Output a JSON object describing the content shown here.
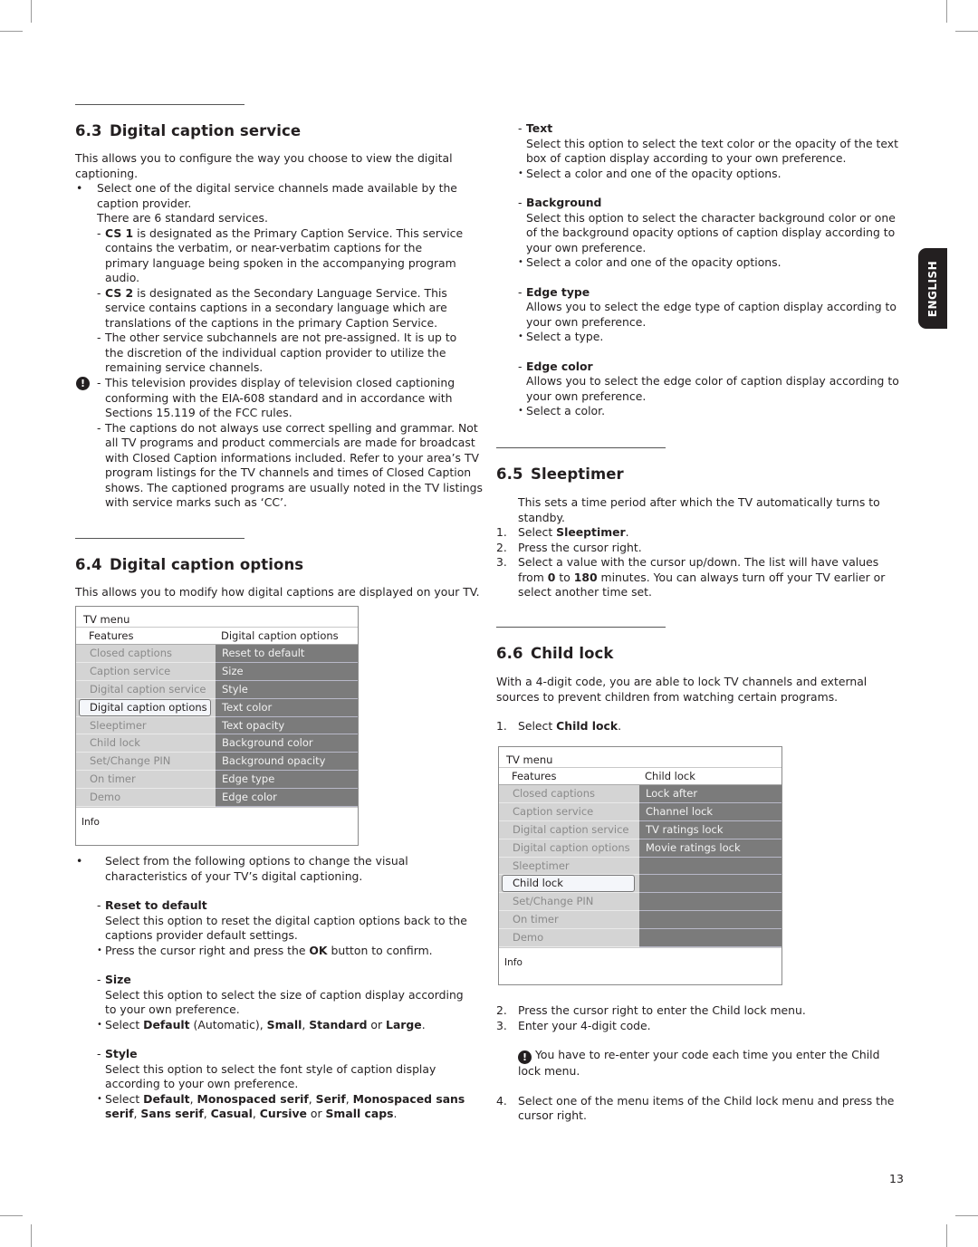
{
  "side_tab": {
    "label": "ENGLISH"
  },
  "page_number": "13",
  "s63": {
    "num": "6.3",
    "title": "Digital caption service",
    "intro": "This allows you to configure the way you choose to view the digital captioning.",
    "bullet": "Select one of the digital service channels made available by the caption provider.",
    "standard": "There are 6 standard services.",
    "items": [
      {
        "bold": "CS 1",
        "text": " is designated as the Primary Caption Service. This service contains the verbatim, or near-verbatim captions for the primary language being spoken in the accompanying program audio."
      },
      {
        "bold": "CS 2",
        "text": " is designated as the Secondary Language Service. This service contains captions in a secondary language which are translations of the captions in the primary Caption Service."
      },
      {
        "bold": "",
        "text": "The other service subchannels are not pre-assigned. It is up to the discretion of the individual caption provider to utilize the remaining service channels."
      }
    ],
    "warn_icon": "!",
    "notes": [
      "This television provides display of television closed captioning conforming with the EIA-608 standard and in accordance with Sections 15.119 of the FCC rules.",
      "The captions do not always use correct spelling and grammar. Not all TV programs and product commercials are made for broadcast with Closed Caption informations included. Refer to your area’s TV program listings for the TV channels and times of Closed Caption shows. The captioned programs are usually noted in the TV listings with service marks such as ‘CC’."
    ]
  },
  "s64": {
    "num": "6.4",
    "title": "Digital caption options",
    "intro": "This allows you to modify how digital captions are displayed on your TV.",
    "menu": {
      "title": "TV menu",
      "left_header": "Features",
      "right_header": "Digital caption options",
      "left_items": [
        "Closed captions",
        "Caption service",
        "Digital caption service",
        "Digital caption options",
        "Sleeptimer",
        "Child lock",
        "Set/Change PIN",
        "On timer",
        "Demo"
      ],
      "selected_index": 3,
      "right_items": [
        "Reset to default",
        "Size",
        "Style",
        "Text color",
        "Text opacity",
        "Background color",
        "Background opacity",
        "Edge type",
        "Edge color"
      ],
      "info": "Info"
    },
    "bullet": "Select from the following options to change the visual characteristics of your TV’s digital captioning.",
    "reset": {
      "title": "Reset to default",
      "desc": "Select this option to reset the digital caption options back to the captions provider default settings.",
      "b_pre": "Press the cursor right and press the ",
      "b_bold": "OK",
      "b_post": " button to confirm."
    },
    "size": {
      "title": "Size",
      "desc": "Select this option to select the size of caption display according to your own preference.",
      "b_pre": "Select ",
      "o1": "Default",
      "t1": " (Automatic), ",
      "o2": "Small",
      "t2": ", ",
      "o3": "Standard",
      "t3": " or ",
      "o4": "Large",
      "t4": "."
    },
    "style": {
      "title": "Style",
      "desc": "Select this option to select the font style of caption display according to your own preference.",
      "b_pre": "Select ",
      "opts": [
        "Default",
        "Monospaced serif",
        "Serif",
        "Monospaced sans serif",
        "Sans serif",
        "Casual",
        "Cursive",
        "Small caps"
      ],
      "sep": ", ",
      "or": " or ",
      "end": "."
    },
    "text": {
      "title": "Text",
      "desc": "Select this option to select the text color or the opacity of the text box of caption display according to your own preference.",
      "bullet": "Select a color and one of the opacity options."
    },
    "background": {
      "title": "Background",
      "desc": "Select this option to select the character background color or one of the background opacity options of caption display according to your own preference.",
      "bullet": "Select a color and one of the opacity options."
    },
    "edge_type": {
      "title": "Edge type",
      "desc": "Allows you to select the edge type of caption display according to your own preference.",
      "bullet": "Select a type."
    },
    "edge_color": {
      "title": "Edge color",
      "desc": "Allows you to select the edge color of caption display according to your own preference.",
      "bullet": "Select a color."
    }
  },
  "s65": {
    "num": "6.5",
    "title": "Sleeptimer",
    "intro": "This sets a time period after which the TV automatically turns to standby.",
    "step1_pre": "Select ",
    "step1_bold": "Sleeptimer",
    "step1_post": ".",
    "step2": "Press the cursor right.",
    "step3_pre": "Select a value with the cursor up/down. The list will have values from ",
    "step3_b1": "0",
    "step3_mid": " to ",
    "step3_b2": "180",
    "step3_post": " minutes. You can always turn off your TV earlier or select another time set."
  },
  "s66": {
    "num": "6.6",
    "title": "Child lock",
    "intro": "With a 4-digit code, you are able to lock TV channels and external sources to prevent children from watching certain programs.",
    "step1_pre": "Select ",
    "step1_bold": "Child lock",
    "step1_post": ".",
    "menu": {
      "title": "TV menu",
      "left_header": "Features",
      "right_header": "Child lock",
      "left_items": [
        "Closed captions",
        "Caption service",
        "Digital caption service",
        "Digital caption options",
        "Sleeptimer",
        "Child lock",
        "Set/Change PIN",
        "On timer",
        "Demo"
      ],
      "selected_index": 5,
      "right_items": [
        "Lock after",
        "Channel lock",
        "TV ratings lock",
        "Movie ratings lock",
        "",
        "",
        "",
        "",
        ""
      ],
      "info": "Info"
    },
    "step2": "Press the cursor right to enter the Child lock menu.",
    "step3": "Enter your 4-digit code.",
    "warn_icon": "!",
    "note": " You have to re-enter your code each time you enter the Child lock menu.",
    "step4": "Select one of the menu items of the Child lock menu and press the cursor right.",
    "nums": [
      "1.",
      "2.",
      "3.",
      "4."
    ]
  }
}
